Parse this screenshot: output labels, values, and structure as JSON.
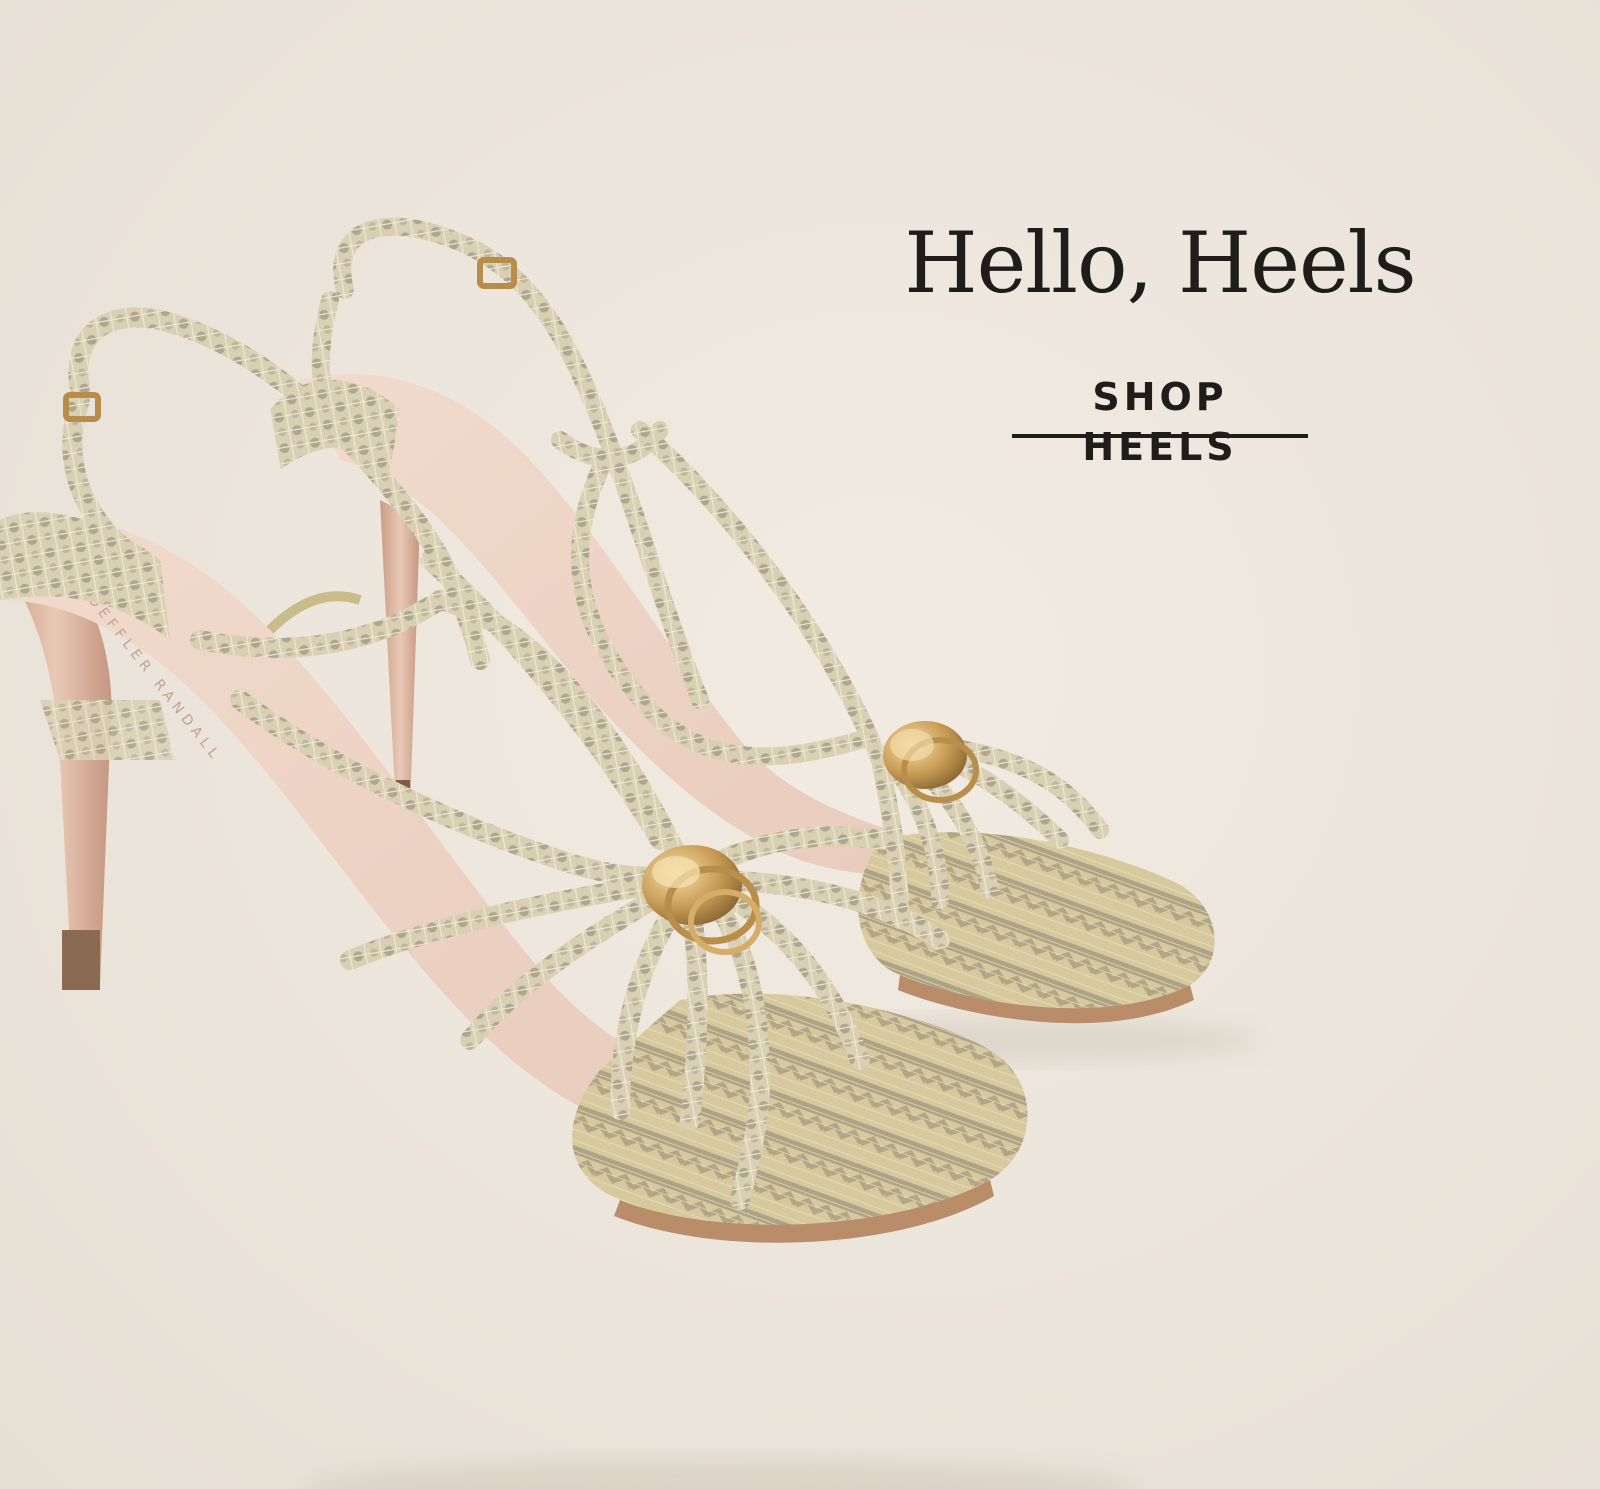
{
  "hero": {
    "headline": "Hello, Heels",
    "cta_label": "SHOP HEELS",
    "image_icon": "strappy-snakeskin-heeled-sandals",
    "insole_brand_text": "LOEFFLER RANDALL"
  },
  "colors": {
    "background": "#ede7de",
    "text": "#1f1d1a",
    "snake_base": "#d8cfb2",
    "snake_spot": "#7d7565",
    "insole": "#eed6c9",
    "gold": "#c79c55"
  }
}
